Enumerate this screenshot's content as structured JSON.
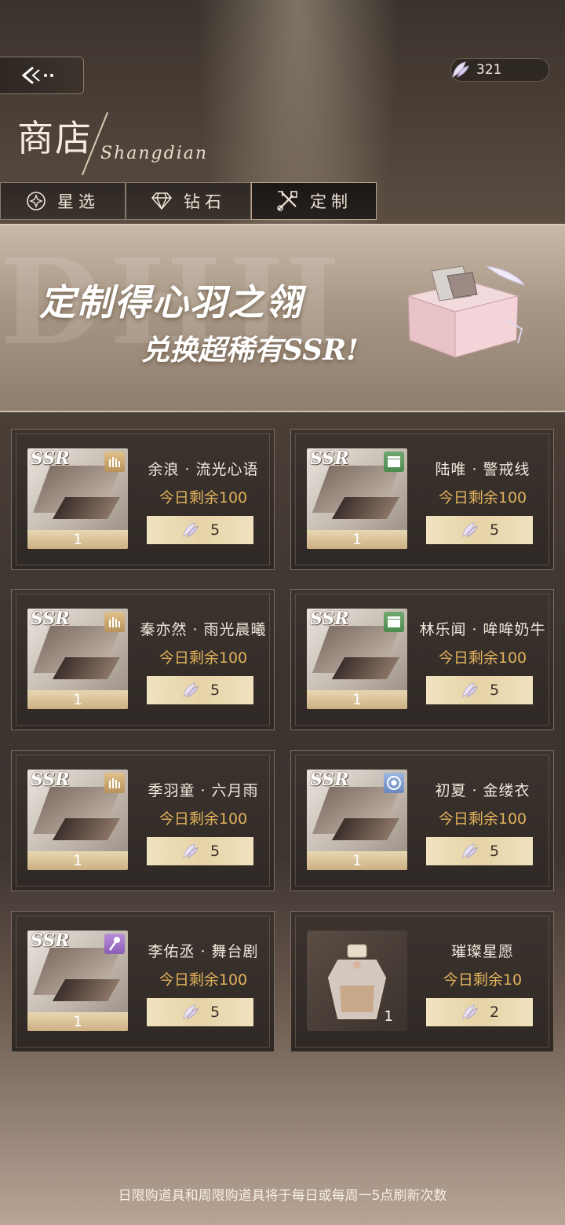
{
  "header": {
    "currency_value": "321",
    "title": "商店",
    "subtitle": "Shangdian"
  },
  "tabs": [
    {
      "label": "星选",
      "icon": "star-circle-icon",
      "active": false
    },
    {
      "label": "钻石",
      "icon": "diamond-icon",
      "active": false
    },
    {
      "label": "定制",
      "icon": "craft-tools-icon",
      "active": true
    }
  ],
  "banner": {
    "bg_text": "DHH",
    "line1": "定制得心羽之翎",
    "line2": "兑换超稀有SSR!"
  },
  "items": [
    {
      "rarity": "SSR",
      "badge": "gold",
      "name": "余浪 · 流光心语",
      "remain": "今日剩余100",
      "qty": "1",
      "price": "5"
    },
    {
      "rarity": "SSR",
      "badge": "green",
      "name": "陆唯 · 警戒线",
      "remain": "今日剩余100",
      "qty": "1",
      "price": "5"
    },
    {
      "rarity": "SSR",
      "badge": "gold",
      "name": "秦亦然 · 雨光晨曦",
      "remain": "今日剩余100",
      "qty": "1",
      "price": "5"
    },
    {
      "rarity": "SSR",
      "badge": "green",
      "name": "林乐闻 · 哞哞奶牛",
      "remain": "今日剩余100",
      "qty": "1",
      "price": "5"
    },
    {
      "rarity": "SSR",
      "badge": "gold",
      "name": "季羽童 · 六月雨",
      "remain": "今日剩余100",
      "qty": "1",
      "price": "5"
    },
    {
      "rarity": "SSR",
      "badge": "blue",
      "name": "初夏 · 金缕衣",
      "remain": "今日剩余100",
      "qty": "1",
      "price": "5"
    },
    {
      "rarity": "SSR",
      "badge": "purple",
      "name": "李佑丞 · 舞台剧",
      "remain": "今日剩余100",
      "qty": "1",
      "price": "5"
    },
    {
      "rarity": "",
      "badge": "",
      "name": "璀璨星愿",
      "remain": "今日剩余10",
      "qty": "1",
      "price": "2"
    }
  ],
  "footer_text": "日限购道具和周限购道具将于每日或每周一5点刷新次数"
}
